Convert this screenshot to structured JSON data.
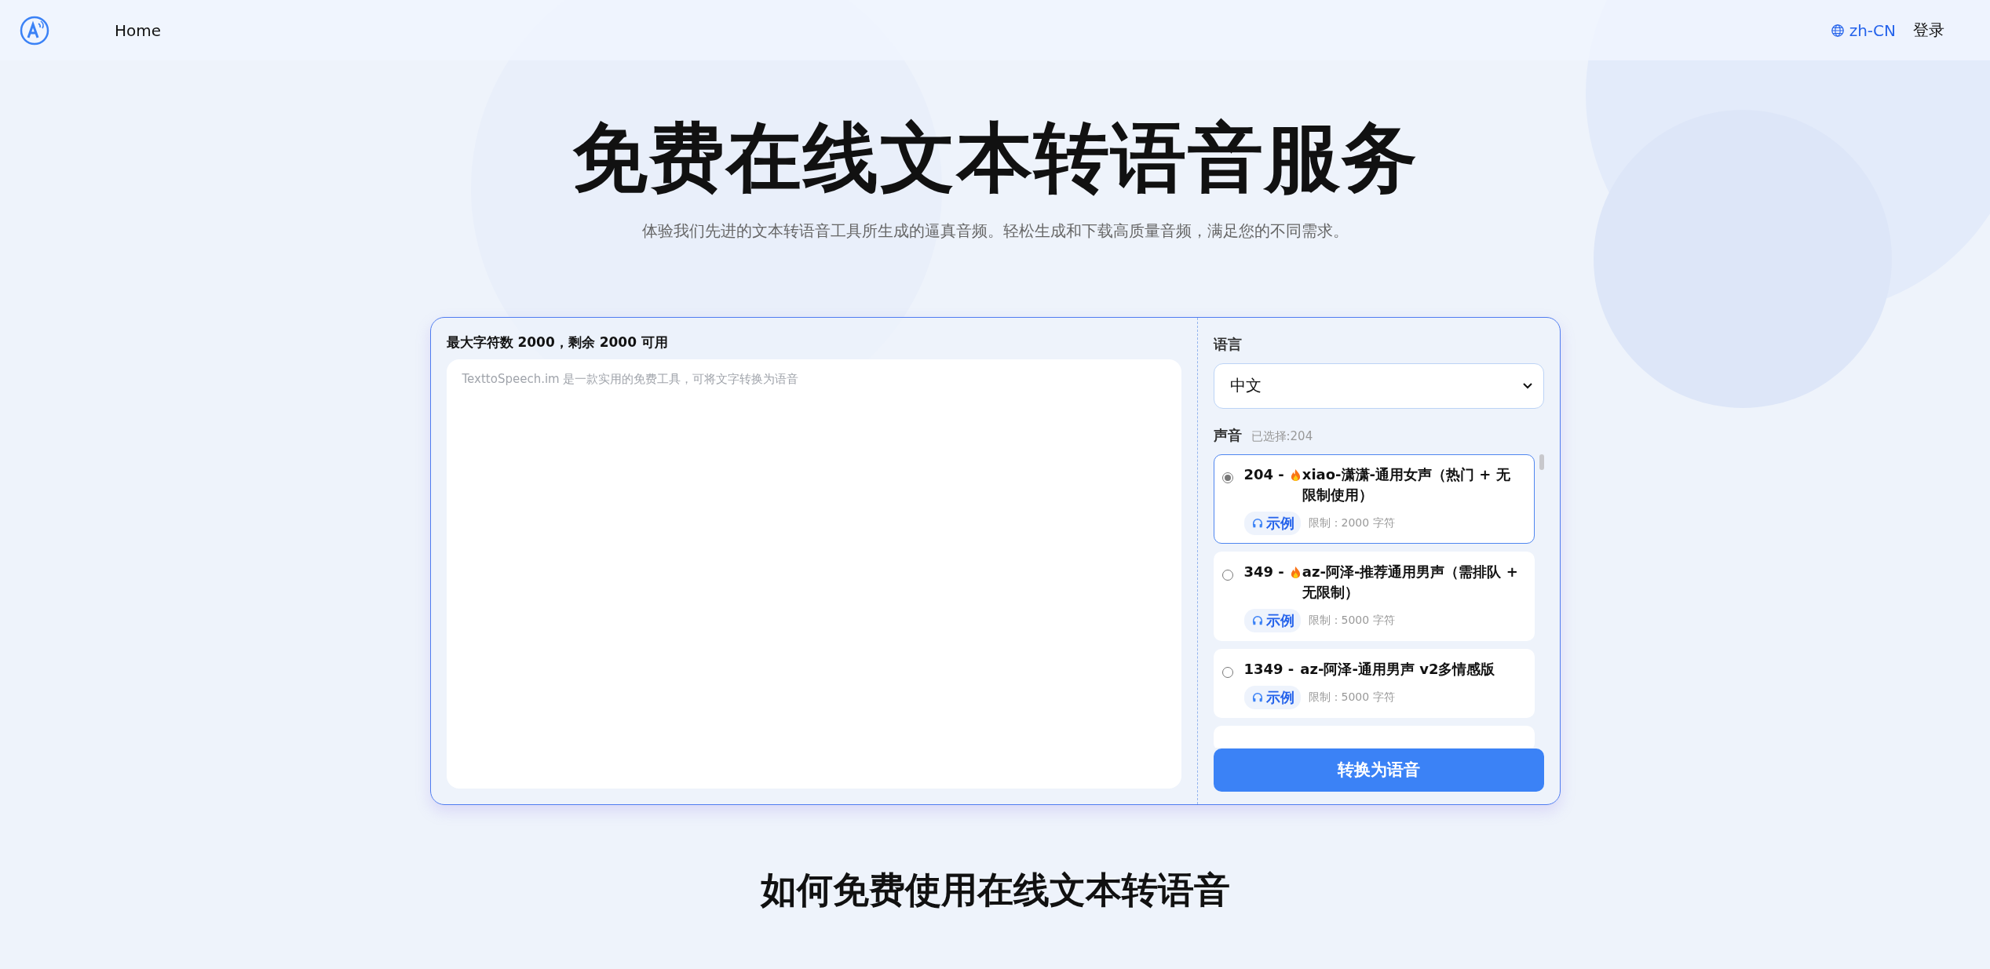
{
  "nav": {
    "home": "Home",
    "language": "zh-CN",
    "login": "登录"
  },
  "hero": {
    "title": "免费在线文本转语音服务",
    "subtitle": "体验我们先进的文本转语音工具所生成的逼真音频。轻松生成和下载高质量音频，满足您的不同需求。"
  },
  "editor": {
    "counter": "最大字符数 2000，剩余 2000 可用",
    "placeholder": "TexttoSpeech.im 是一款实用的免费工具，可将文字转换为语音"
  },
  "settings": {
    "language_label": "语言",
    "language_value": "中文",
    "voice_label": "声音",
    "voice_selected": "已选择:204",
    "voices": [
      {
        "code": "204 -",
        "hot": true,
        "name": "xiao-潇潇-通用女声（热门 + 无限制使用）",
        "sample": "示例",
        "limit": "限制：2000 字符",
        "selected": true
      },
      {
        "code": "349 -",
        "hot": true,
        "name": "az-阿泽-推荐通用男声（需排队 + 无限制）",
        "sample": "示例",
        "limit": "限制：5000 字符",
        "selected": false
      },
      {
        "code": "1349 -",
        "hot": false,
        "name": "az-阿泽-通用男声 v2多情感版",
        "sample": "示例",
        "limit": "限制：5000 字符",
        "selected": false
      }
    ],
    "convert": "转换为语音"
  },
  "section_heading": "如何免费使用在线文本转语音"
}
